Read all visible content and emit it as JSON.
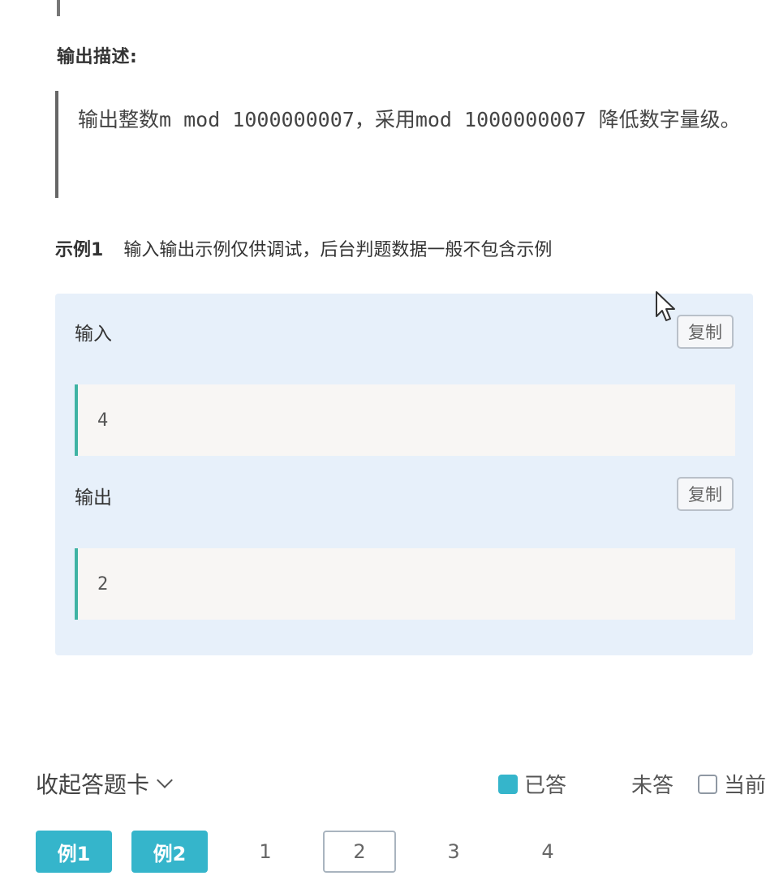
{
  "output_section": {
    "title": "输出描述:",
    "text": "输出整数m mod 1000000007，采用mod 1000000007 降低数字量级。"
  },
  "example": {
    "label": "示例1",
    "note": "输入输出示例仅供调试，后台判题数据一般不包含示例",
    "input_label": "输入",
    "input_value": "4",
    "output_label": "输出",
    "output_value": "2",
    "copy_label": "复制"
  },
  "answer_card": {
    "toggle_label": "收起答题卡",
    "legend": {
      "answered": "已答",
      "unanswered": "未答",
      "current": "当前"
    },
    "items": [
      {
        "label": "例1",
        "state": "answered"
      },
      {
        "label": "例2",
        "state": "answered"
      },
      {
        "label": "1",
        "state": "unanswered"
      },
      {
        "label": "2",
        "state": "current"
      },
      {
        "label": "3",
        "state": "unanswered"
      },
      {
        "label": "4",
        "state": "unanswered"
      }
    ]
  },
  "colors": {
    "answered": "#35b5cb",
    "code_accent": "#3fb3a4",
    "example_bg": "#e7f0fa"
  },
  "icons": [
    "chevron-down-icon",
    "cursor-icon"
  ]
}
